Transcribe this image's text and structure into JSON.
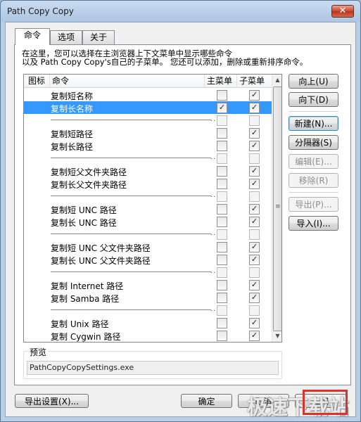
{
  "window": {
    "title": "Path Copy Copy",
    "close_symbol": "✕"
  },
  "tabs": [
    {
      "label": "命令",
      "active": true
    },
    {
      "label": "选项",
      "active": false
    },
    {
      "label": "关于",
      "active": false
    }
  ],
  "description": {
    "line1": "在这里，您可以选择在主浏览器上下文菜单中显示哪些命令",
    "line2": "以及 Path Copy Copy's自己的子菜单。 您还可以添加，删除或重新排序命令。"
  },
  "list": {
    "headers": {
      "icon": "图标",
      "command": "命令",
      "main_menu": "主菜单",
      "submenu": "子菜单"
    },
    "separator_text": "...",
    "rows": [
      {
        "type": "item",
        "label": "复制短名称",
        "main": false,
        "sub": true,
        "selected": false
      },
      {
        "type": "item",
        "label": "复制长名称",
        "main": true,
        "sub": true,
        "selected": true
      },
      {
        "type": "separator",
        "main": false,
        "sub": false
      },
      {
        "type": "item",
        "label": "复制短路径",
        "main": false,
        "sub": true,
        "selected": false
      },
      {
        "type": "item",
        "label": "复制长路径",
        "main": false,
        "sub": true,
        "selected": false
      },
      {
        "type": "separator",
        "main": false,
        "sub": false
      },
      {
        "type": "item",
        "label": "复制短父文件夹路径",
        "main": false,
        "sub": true,
        "selected": false
      },
      {
        "type": "item",
        "label": "复制长父文件夹路径",
        "main": false,
        "sub": true,
        "selected": false
      },
      {
        "type": "separator",
        "main": false,
        "sub": false
      },
      {
        "type": "item",
        "label": "复制短 UNC 路径",
        "main": false,
        "sub": true,
        "selected": false
      },
      {
        "type": "item",
        "label": "复制长 UNC 路径",
        "main": false,
        "sub": true,
        "selected": false
      },
      {
        "type": "separator",
        "main": false,
        "sub": false
      },
      {
        "type": "item",
        "label": "复制短 UNC 父文件夹路径",
        "main": false,
        "sub": true,
        "selected": false
      },
      {
        "type": "item",
        "label": "复制长 UNC 父文件夹路径",
        "main": false,
        "sub": true,
        "selected": false
      },
      {
        "type": "separator",
        "main": false,
        "sub": false
      },
      {
        "type": "item",
        "label": "复制 Internet 路径",
        "main": false,
        "sub": true,
        "selected": false
      },
      {
        "type": "item",
        "label": "复制 Samba 路径",
        "main": false,
        "sub": true,
        "selected": false
      },
      {
        "type": "separator",
        "main": false,
        "sub": false
      },
      {
        "type": "item",
        "label": "复制 Unix 路径",
        "main": false,
        "sub": true,
        "selected": false
      },
      {
        "type": "item",
        "label": "复制 Cygwin 路径",
        "main": false,
        "sub": true,
        "selected": false
      }
    ]
  },
  "side_buttons": {
    "move_up": "向上(U)",
    "move_down": "向下(D)",
    "new": "新建(N)...",
    "separator": "分隔器(S)",
    "edit": "编辑(E)...",
    "remove": "移除(R)",
    "export": "导出(P)...",
    "import": "导入(I)..."
  },
  "preview": {
    "label": "预览",
    "value": "PathCopyCopySettings.exe"
  },
  "footer": {
    "export_settings": "导出设置(X)...",
    "ok": "确定",
    "cancel": "取消",
    "apply": "应用"
  },
  "watermark": {
    "text": "极速下载站"
  },
  "icons": {
    "check": "✓",
    "arrow_up": "▲",
    "arrow_down": "▼",
    "grip": "≡"
  },
  "colors": {
    "selection": "#3399ff",
    "title_bar": "#aec6e2",
    "close_button": "#c7452c"
  }
}
